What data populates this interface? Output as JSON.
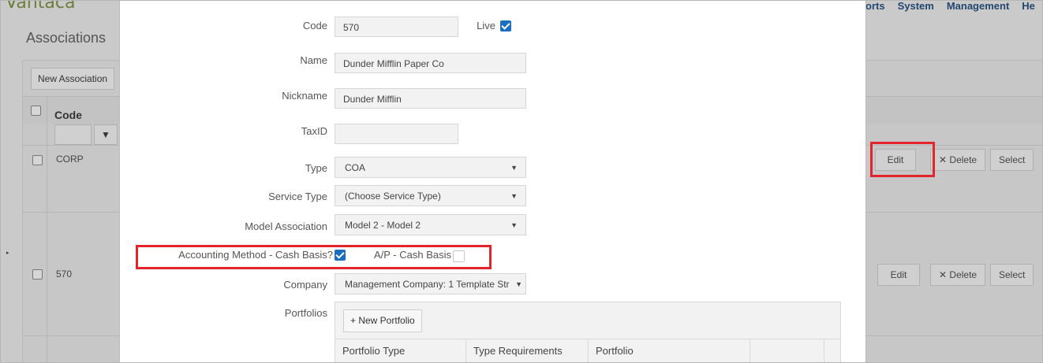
{
  "background": {
    "logo": "Vantaca",
    "nav": [
      "orts",
      "System",
      "Management",
      "He"
    ],
    "page_title": "Associations",
    "new_association_button": "New Association",
    "grid": {
      "code_header": "Code",
      "filter_icon": "filter-icon",
      "rows": [
        {
          "code": "CORP",
          "edit": "Edit",
          "delete": "Delete",
          "select": "Select"
        },
        {
          "code": "570",
          "edit": "Edit",
          "delete": "Delete",
          "select": "Select"
        }
      ]
    }
  },
  "modal": {
    "fields": {
      "code_label": "Code",
      "code_value": "570",
      "live_label": "Live",
      "live_checked": true,
      "name_label": "Name",
      "name_value": "Dunder Mifflin Paper Co",
      "nickname_label": "Nickname",
      "nickname_value": "Dunder Mifflin",
      "taxid_label": "TaxID",
      "taxid_value": "",
      "type_label": "Type",
      "type_value": "COA",
      "service_type_label": "Service Type",
      "service_type_value": "(Choose Service Type)",
      "model_association_label": "Model Association",
      "model_association_value": "Model 2 - Model 2",
      "accounting_method_label": "Accounting Method - Cash Basis?",
      "accounting_method_checked": true,
      "ap_cash_basis_label": "A/P - Cash Basis",
      "ap_cash_basis_checked": false,
      "company_label": "Company",
      "company_value": "Management Company: 1 Template Str",
      "portfolios_label": "Portfolios"
    },
    "portfolios": {
      "new_portfolio_button": "+ New Portfolio",
      "columns": [
        "Portfolio Type",
        "Type Requirements",
        "Portfolio",
        ""
      ]
    }
  },
  "colors": {
    "highlight": "#e3242b",
    "checkbox_checked": "#1a6fc0",
    "nav_text": "#24476f"
  }
}
